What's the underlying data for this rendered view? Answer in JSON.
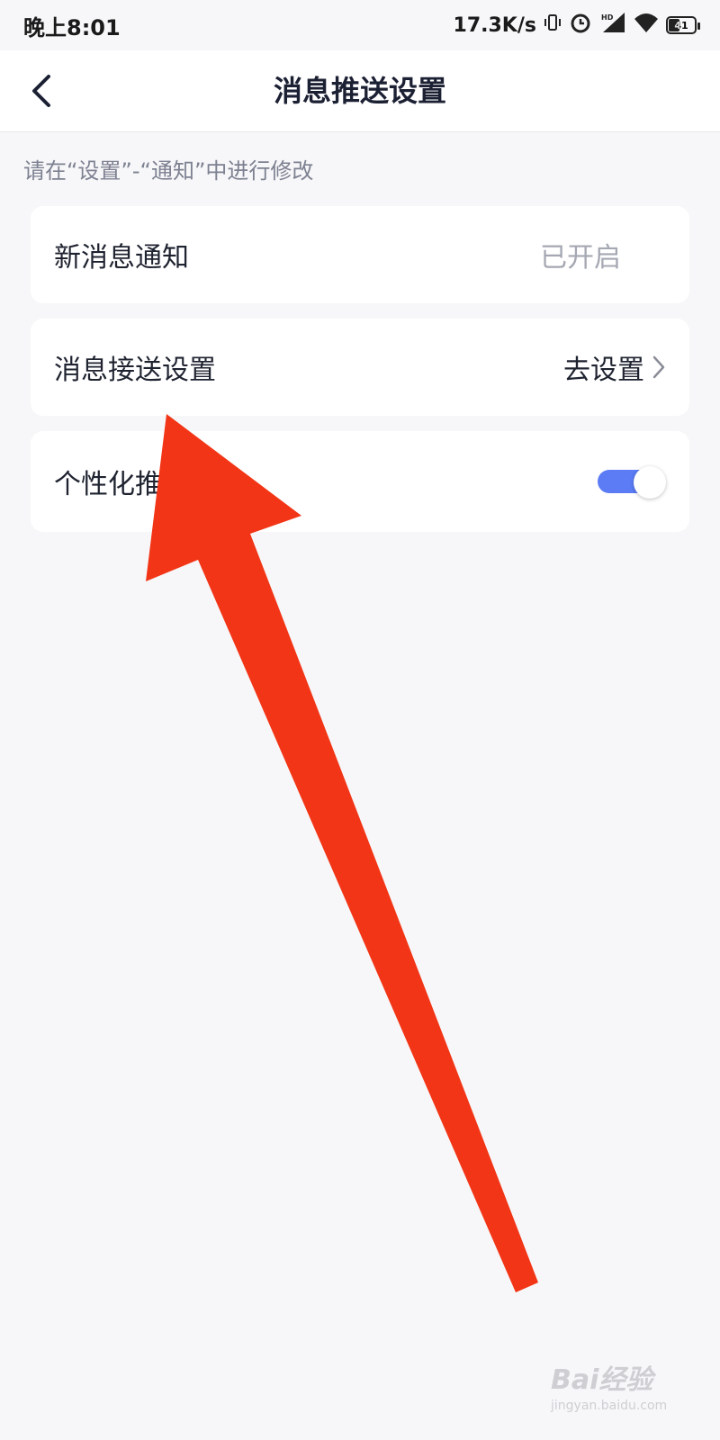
{
  "status_bar": {
    "time": "晚上8:01",
    "network_speed": "17.3K/s",
    "icons": [
      "vibrate-icon",
      "alarm-icon",
      "hd-signal-icon",
      "wifi-icon",
      "battery-icon"
    ],
    "battery_level": "41"
  },
  "navbar": {
    "title": "消息推送设置",
    "back_icon": "chevron-left-icon"
  },
  "hint": "请在“设置”-“通知”中进行修改",
  "settings": [
    {
      "label": "新消息通知",
      "value": "已开启"
    },
    {
      "label": "消息接送设置",
      "action": "去设置"
    },
    {
      "label": "个性化推",
      "toggle_on": true
    }
  ],
  "watermark": {
    "brand": "Bai经验",
    "site": "jingyan.baidu.com"
  },
  "colors": {
    "accent": "#5b7cf5",
    "annotation_arrow": "#f23516",
    "background": "#f7f7f9"
  }
}
